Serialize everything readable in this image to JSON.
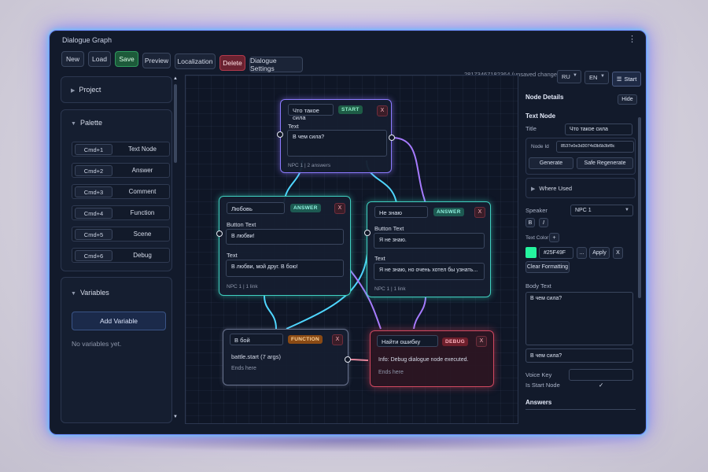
{
  "window": {
    "title": "Dialogue Graph"
  },
  "toolbar": {
    "new": "New",
    "load": "Load",
    "save": "Save",
    "preview": "Preview",
    "localization": "Localization",
    "delete": "Delete",
    "dialogue_settings": "Dialogue Settings"
  },
  "status": {
    "changes": "28173467182364 (unsaved changes)"
  },
  "lang": {
    "from": "RU",
    "to": "EN"
  },
  "start_button": "Start",
  "left": {
    "project": "Project",
    "palette": {
      "title": "Palette",
      "items": [
        {
          "key": "Cmd+1",
          "label": "Text Node"
        },
        {
          "key": "Cmd+2",
          "label": "Answer"
        },
        {
          "key": "Cmd+3",
          "label": "Comment"
        },
        {
          "key": "Cmd+4",
          "label": "Function"
        },
        {
          "key": "Cmd+5",
          "label": "Scene"
        },
        {
          "key": "Cmd+6",
          "label": "Debug"
        }
      ]
    },
    "variables": {
      "title": "Variables",
      "add": "Add Variable",
      "empty": "No variables yet."
    }
  },
  "nodes": {
    "start": {
      "title": "Что такое сила",
      "badge": "START",
      "close": "X",
      "text_label": "Text",
      "text": "В чем сила?",
      "footer": "NPC 1 | 2 answers"
    },
    "answer1": {
      "title": "Любовь",
      "badge": "ANSWER",
      "close": "X",
      "btn_label": "Button Text",
      "btn_text": "В любви!",
      "text_label": "Text",
      "text": "В любви, мой друг. В бою!",
      "footer": "NPC 1 | 1 link"
    },
    "answer2": {
      "title": "Не знаю",
      "badge": "ANSWER",
      "close": "X",
      "btn_label": "Button Text",
      "btn_text": "Я не знаю.",
      "text_label": "Text",
      "text": "Я не знаю, но очень хотел бы узнать...",
      "footer": "NPC 1 | 1 link"
    },
    "function": {
      "title": "В бой",
      "badge": "FUNCTION",
      "close": "X",
      "call": "battle.start (7 args)",
      "ends": "Ends here"
    },
    "debug": {
      "title": "Найти ошибку",
      "badge": "DEBUG",
      "close": "X",
      "info": "Info: Debug dialogue node executed.",
      "ends": "Ends here"
    }
  },
  "details": {
    "title": "Node Details",
    "hide": "Hide",
    "type": "Text Node",
    "title_label": "Title",
    "title_value": "Что такое сила",
    "node_id_label": "Node Id",
    "node_id_value": "8537e0e3d3074d3b5b3bf8c",
    "generate": "Generate",
    "safe_regenerate": "Safe Regenerate",
    "where_used": "Where Used",
    "speaker_label": "Speaker",
    "speaker_value": "NPC 1",
    "bold": "B",
    "italic": "I",
    "text_color_label": "Text Color",
    "plus": "+",
    "color_value": "#25F49F",
    "color_hex": "#25f49f",
    "ellipsis": "...",
    "apply": "Apply",
    "clear_x": "X",
    "clear_formatting": "Clear Formatting",
    "body_label": "Body Text",
    "body_value": "В чем сила?",
    "preview_value": "В чем сила?",
    "voice_key_label": "Voice Key",
    "is_start_label": "Is Start Node",
    "is_start_checked": "✓",
    "answers": "Answers"
  },
  "colors": {
    "start": "#8d7bff",
    "answer": "#3fd0c0",
    "link_cyan": "#4fd6ff",
    "link_purple": "#a67bff",
    "debug": "#d04860"
  }
}
